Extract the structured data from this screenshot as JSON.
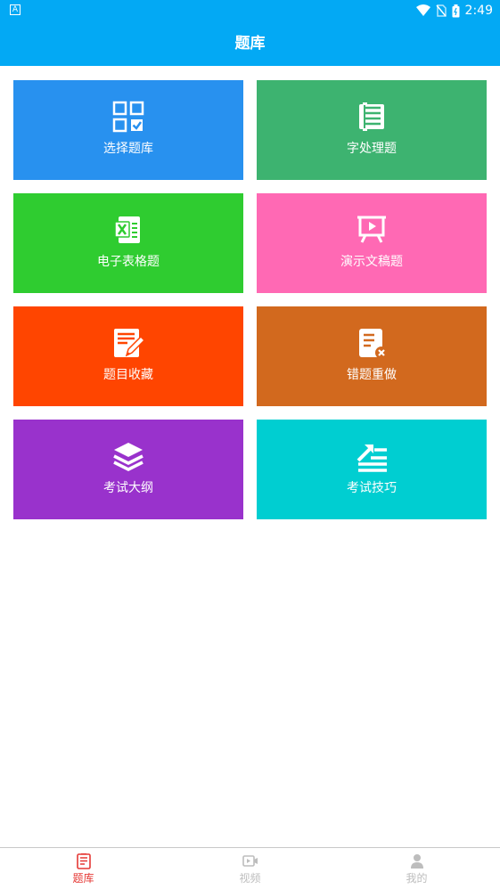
{
  "status_bar": {
    "time": "2:49"
  },
  "app_bar": {
    "title": "题库"
  },
  "tiles": [
    {
      "label": "选择题库",
      "icon": "checklist-grid-icon",
      "color": "#2891ef"
    },
    {
      "label": "字处理题",
      "icon": "document-list-icon",
      "color": "#3db370"
    },
    {
      "label": "电子表格题",
      "icon": "excel-icon",
      "color": "#2fcc30"
    },
    {
      "label": "演示文稿题",
      "icon": "presentation-icon",
      "color": "#ff69b4"
    },
    {
      "label": "题目收藏",
      "icon": "note-edit-icon",
      "color": "#ff4500"
    },
    {
      "label": "错题重做",
      "icon": "wrong-note-icon",
      "color": "#d2691e"
    },
    {
      "label": "考试大纲",
      "icon": "layers-icon",
      "color": "#9932cc"
    },
    {
      "label": "考试技巧",
      "icon": "trend-list-icon",
      "color": "#00ced1"
    }
  ],
  "bottom_nav": {
    "active_color": "#e53935",
    "inactive_color": "#bdbdbd",
    "items": [
      {
        "label": "题库",
        "icon": "question-bank-icon",
        "active": true
      },
      {
        "label": "视频",
        "icon": "video-icon",
        "active": false
      },
      {
        "label": "我的",
        "icon": "person-icon",
        "active": false
      }
    ]
  }
}
